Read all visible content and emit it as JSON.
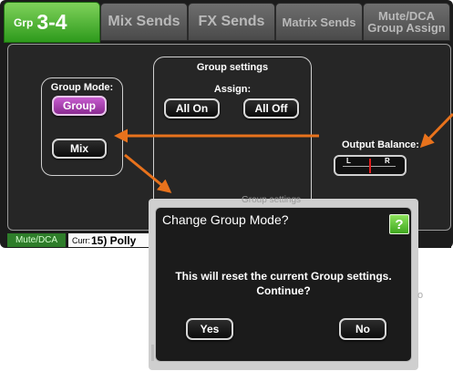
{
  "tabs": {
    "group": {
      "prefix": "Grp",
      "label": "3-4"
    },
    "mix_sends": "Mix Sends",
    "fx_sends": "FX Sends",
    "matrix_sends": "Matrix Sends",
    "mute_dca_line1": "Mute/DCA",
    "mute_dca_line2": "Group Assign"
  },
  "group_mode": {
    "title": "Group Mode:",
    "group_button": "Group",
    "mix_button": "Mix"
  },
  "group_settings": {
    "title": "Group settings",
    "assign_label": "Assign:",
    "all_on": "All On",
    "all_off": "All Off",
    "faded_title": "Group settings"
  },
  "output_balance": {
    "label": "Output Balance:",
    "left": "L",
    "right": "R",
    "value": 0
  },
  "bottom_bar": {
    "mute_dca": "Mute/DCA",
    "current_prefix": "Curr:",
    "current_value": "15) Polly"
  },
  "dialog": {
    "title": "Change Group Mode?",
    "help": "?",
    "message_line1": "This will reset the current Group settings.",
    "message_line2": "Continue?",
    "yes": "Yes",
    "no": "No"
  },
  "colors": {
    "active_tab": "#3fa71f",
    "purple_button": "#a83bb0",
    "arrow": "#e8721c",
    "balance_marker": "#e21b1b"
  }
}
